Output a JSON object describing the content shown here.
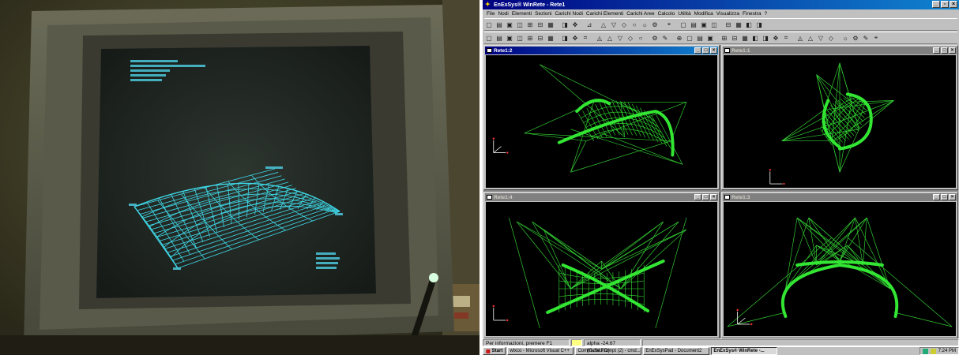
{
  "photo": {
    "crt_text_lines": [
      "...",
      "..."
    ],
    "label_top": "...",
    "label_left": "...",
    "label_right": "...",
    "label_bottom": "..."
  },
  "app": {
    "title": "EnExSys® WinRete - Rete1",
    "menu": [
      "File",
      "Nodi",
      "Elementi",
      "Sezioni",
      "Carichi Nodi",
      "Carichi Elementi",
      "Carichi Aree",
      "Calcolo",
      "Utilità",
      "Modifica",
      "Visualizza",
      "Finestra",
      "?"
    ],
    "toolbar1_icons": [
      "new-icon",
      "open-icon",
      "save-icon",
      "print-icon",
      "zoom-icon",
      "zoom-out-icon",
      "window-icon",
      "sep",
      "view-icon",
      "view-2-icon",
      "sep",
      "node-icon",
      "sep",
      "mesh-icon",
      "mesh-2-icon",
      "mesh-3-icon",
      "eye-icon",
      "shade-icon",
      "color-icon",
      "sep",
      "grid-icon",
      "sep",
      "star-icon",
      "circle-icon",
      "axis-icon",
      "calc-icon",
      "sep",
      "persp-icon",
      "persp-2-icon",
      "persp-3-icon",
      "persp-4-icon"
    ],
    "toolbar2_icons": [
      "tool-a-icon",
      "grid-b-icon",
      "tool-c-icon",
      "tool-d-icon",
      "tool-e-icon",
      "tool-f-icon",
      "tool-g-icon",
      "sep",
      "line-icon",
      "table-icon",
      "tool-h-icon",
      "sep",
      "tool-i-icon",
      "tool-j-icon",
      "tool-k-icon",
      "tool-l-icon",
      "tool-m-icon",
      "sep",
      "tool-n-icon",
      "tool-o-icon",
      "sep",
      "tool-p-icon",
      "tool-q-icon",
      "tool-r-icon",
      "tool-s-icon",
      "sep",
      "tool-t-icon",
      "tool-u-icon",
      "tool-v-icon",
      "tool-w-icon",
      "tool-x-icon",
      "tool-y-icon",
      "tool-z-icon",
      "sep",
      "tool-aa-icon",
      "tool-ab-icon",
      "tool-ac-icon",
      "tool-ad-icon",
      "sep",
      "tool-ae-icon",
      "tool-af-icon",
      "tool-ag-icon",
      "tool-ah-icon"
    ],
    "windows": [
      {
        "id": "rete1-2",
        "title": "Rete1:2",
        "active": true,
        "view": "perspective"
      },
      {
        "id": "rete1-1",
        "title": "Rete1:1",
        "active": false,
        "view": "top"
      },
      {
        "id": "rete1-4",
        "title": "Rete1:4",
        "active": false,
        "view": "front"
      },
      {
        "id": "rete1-3",
        "title": "Rete1:3",
        "active": false,
        "view": "side"
      }
    ],
    "status": {
      "hint": "Per informazioni, premere F1",
      "alpha": "alpha -24.67 (G.Sez.D)"
    },
    "taskbar": {
      "start": "Start",
      "tasks": [
        {
          "label": "wlxco - Microsoft Visual C++",
          "pressed": false
        },
        {
          "label": "Command Prompt (2) - cmd...",
          "pressed": false
        },
        {
          "label": "EnExSysPad - Document2",
          "pressed": false
        },
        {
          "label": "EnExSys® WinRete -...",
          "pressed": true
        }
      ],
      "clock": "7:24 PM"
    },
    "colors": {
      "mesh": "#33e633",
      "cable": "#33cc33",
      "crt_cyan": "#3fd8e8",
      "title_active": "#000080"
    }
  }
}
